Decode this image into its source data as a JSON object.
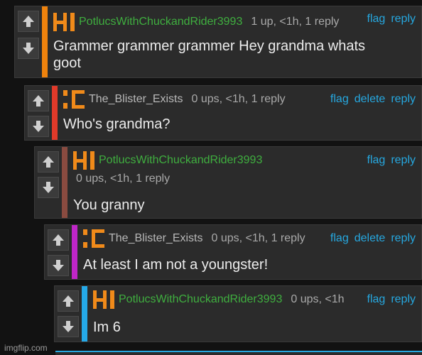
{
  "comments": [
    {
      "user": "PotlucsWithChuckandRider3993",
      "stats": "1 up, <1h, 1 reply",
      "actions": [
        "flag",
        "reply"
      ],
      "text_line1": "Grammer grammer grammer Hey grandma whats",
      "text_line2": "goot",
      "bar_color": "#f0830d",
      "avatar": "HI"
    },
    {
      "user": "The_Blister_Exists",
      "stats": "0 ups, <1h, 1 reply",
      "actions": [
        "flag",
        "delete",
        "reply"
      ],
      "text_line1": "Who's grandma?",
      "bar_color": "#e23a2a",
      "avatar": "IC"
    },
    {
      "user": "PotlucsWithChuckandRider3993",
      "stats": "0 ups, <1h, 1 reply",
      "actions": [
        "flag",
        "reply"
      ],
      "text_line1": "You granny",
      "bar_color": "#8a4b40",
      "avatar": "HI"
    },
    {
      "user": "The_Blister_Exists",
      "stats": "0 ups, <1h, 1 reply",
      "actions": [
        "flag",
        "delete",
        "reply"
      ],
      "text_line1": "At least I am not a youngster!",
      "bar_color": "#c026c8",
      "avatar": "IC"
    },
    {
      "user": "PotlucsWithChuckandRider3993",
      "stats": "0 ups, <1h",
      "actions": [
        "flag",
        "reply"
      ],
      "text_line1": "Im 6",
      "bar_color": "#25a9e8",
      "avatar": "HI"
    }
  ],
  "watermark": "imgflip.com",
  "icons": {
    "upvote": "upvote-arrow-icon",
    "downvote": "downvote-arrow-icon"
  }
}
